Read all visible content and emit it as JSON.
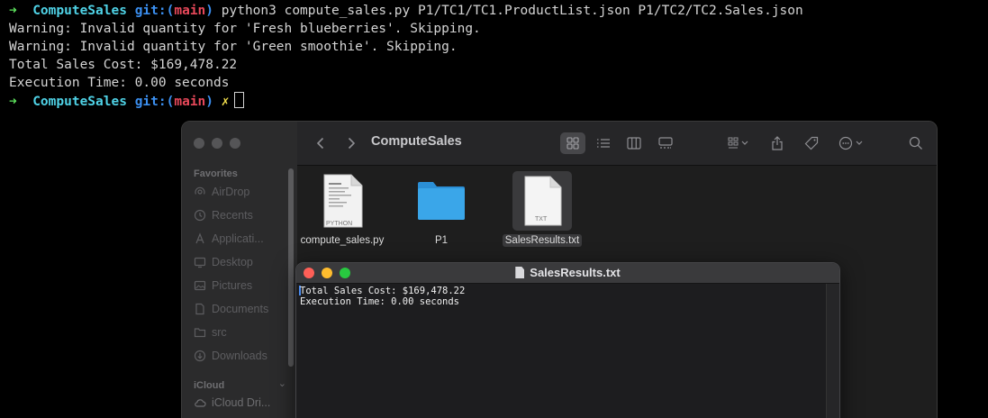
{
  "terminal": {
    "line1": {
      "arrow": "➜",
      "dir": "ComputeSales",
      "git_label": "git:(",
      "branch": "main",
      "git_close": ")",
      "command": "python3 compute_sales.py P1/TC1/TC1.ProductList.json P1/TC2/TC2.Sales.json"
    },
    "output": [
      "Warning: Invalid quantity for 'Fresh blueberries'. Skipping.",
      "Warning: Invalid quantity for 'Green smoothie'. Skipping.",
      "Total Sales Cost: $169,478.22",
      "Execution Time: 0.00 seconds"
    ],
    "prompt": {
      "arrow": "➜",
      "dir": "ComputeSales",
      "git_label": "git:(",
      "branch": "main",
      "git_close": ")",
      "dirty": "✗"
    }
  },
  "finder": {
    "title": "ComputeSales",
    "sidebar": {
      "favorites_label": "Favorites",
      "icloud_label": "iCloud",
      "items": [
        {
          "label": "AirDrop",
          "icon": "airdrop-icon"
        },
        {
          "label": "Recents",
          "icon": "clock-icon"
        },
        {
          "label": "Applicati...",
          "icon": "applications-icon"
        },
        {
          "label": "Desktop",
          "icon": "desktop-icon"
        },
        {
          "label": "Pictures",
          "icon": "pictures-icon"
        },
        {
          "label": "Documents",
          "icon": "document-icon"
        },
        {
          "label": "src",
          "icon": "folder-icon"
        },
        {
          "label": "Downloads",
          "icon": "download-icon"
        }
      ],
      "icloud_items": [
        {
          "label": "iCloud Dri...",
          "icon": "cloud-icon"
        }
      ]
    },
    "files": [
      {
        "name": "compute_sales.py",
        "badge": "PYTHON",
        "type": "python-file",
        "selected": false
      },
      {
        "name": "P1",
        "badge": "",
        "type": "folder",
        "selected": false
      },
      {
        "name": "SalesResults.txt",
        "badge": "TXT",
        "type": "text-file",
        "selected": true
      }
    ]
  },
  "textedit": {
    "title": "SalesResults.txt",
    "lines": [
      "Total Sales Cost: $169,478.22",
      "Execution Time: 0.00 seconds"
    ]
  },
  "colors": {
    "terminal_bg": "#000000",
    "prompt_arrow": "#5ee35e",
    "prompt_dir": "#4fd2e6",
    "git_label": "#3b8ff0",
    "branch": "#e8485a",
    "dirty_mark": "#f4e04d",
    "folder_blue": "#3aa6e9",
    "close_red": "#ff5f57",
    "minimize_yellow": "#febc2e",
    "zoom_green": "#28c840"
  }
}
